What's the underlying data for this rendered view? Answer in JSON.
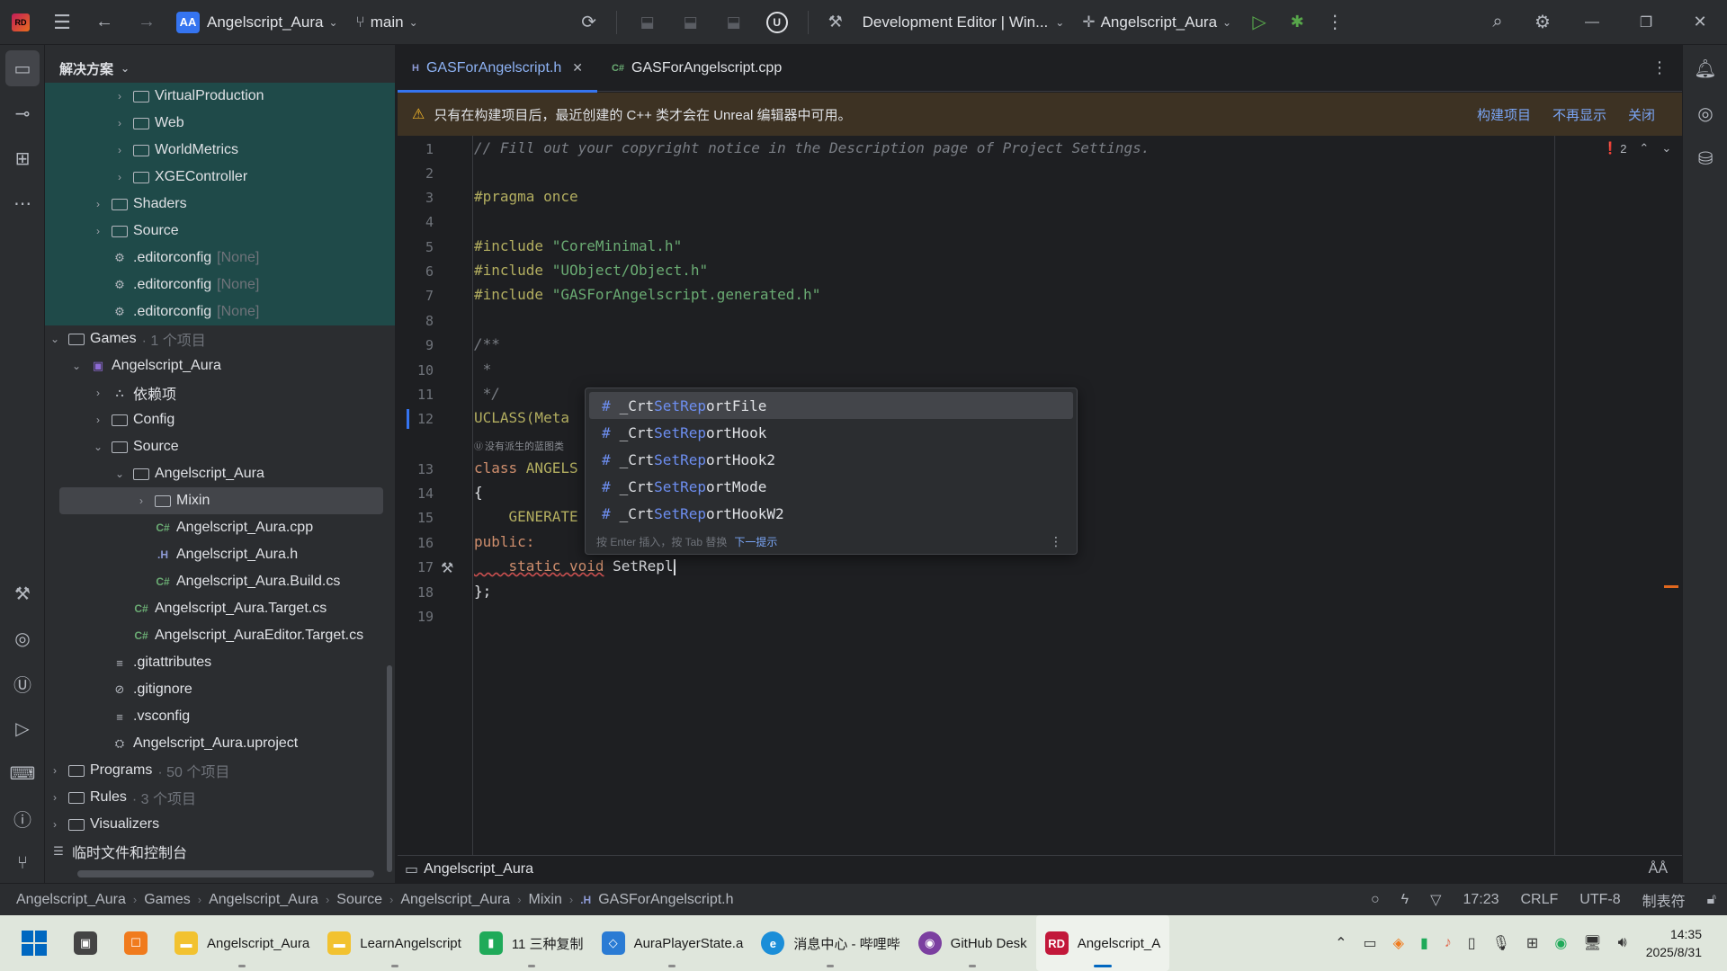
{
  "titlebar": {
    "project_badge": "AA",
    "project_name": "Angelscript_Aura",
    "branch": "main",
    "config": "Development Editor | Win...",
    "run_target": "Angelscript_Aura"
  },
  "explorer": {
    "title": "解决方案",
    "rows": [
      {
        "label": "VirtualProduction",
        "extra": ""
      },
      {
        "label": "Web",
        "extra": ""
      },
      {
        "label": "WorldMetrics",
        "extra": ""
      },
      {
        "label": "XGEController",
        "extra": ""
      },
      {
        "label": "Shaders",
        "extra": ""
      },
      {
        "label": "Source",
        "extra": ""
      },
      {
        "label": ".editorconfig",
        "extra": "[None]"
      },
      {
        "label": ".editorconfig",
        "extra": "[None]"
      },
      {
        "label": ".editorconfig",
        "extra": "[None]"
      },
      {
        "label": "Games",
        "extra": "· 1 个项目"
      },
      {
        "label": "Angelscript_Aura",
        "extra": ""
      },
      {
        "label": "依赖项",
        "extra": ""
      },
      {
        "label": "Config",
        "extra": ""
      },
      {
        "label": "Source",
        "extra": ""
      },
      {
        "label": "Angelscript_Aura",
        "extra": ""
      },
      {
        "label": "Mixin",
        "extra": ""
      },
      {
        "label": "Angelscript_Aura.cpp",
        "extra": ""
      },
      {
        "label": "Angelscript_Aura.h",
        "extra": ""
      },
      {
        "label": "Angelscript_Aura.Build.cs",
        "extra": ""
      },
      {
        "label": "Angelscript_Aura.Target.cs",
        "extra": ""
      },
      {
        "label": "Angelscript_AuraEditor.Target.cs",
        "extra": ""
      },
      {
        "label": ".gitattributes",
        "extra": ""
      },
      {
        "label": ".gitignore",
        "extra": ""
      },
      {
        "label": ".vsconfig",
        "extra": ""
      },
      {
        "label": "Angelscript_Aura.uproject",
        "extra": ""
      },
      {
        "label": "Programs",
        "extra": "· 50 个项目"
      },
      {
        "label": "Rules",
        "extra": "· 3 个项目"
      },
      {
        "label": "Visualizers",
        "extra": ""
      },
      {
        "label": "临时文件和控制台",
        "extra": ""
      }
    ]
  },
  "tabs": [
    {
      "ext": "H",
      "label": "GASForAngelscript.h"
    },
    {
      "ext": "C#",
      "label": "GASForAngelscript.cpp"
    }
  ],
  "banner": {
    "message": "只有在构建项目后，最近创建的 C++ 类才会在 Unreal 编辑器中可用。",
    "build": "构建项目",
    "dont_show": "不再显示",
    "close": "关闭"
  },
  "editor": {
    "error_count": "2",
    "line_numbers": [
      "1",
      "2",
      "3",
      "4",
      "5",
      "6",
      "7",
      "8",
      "9",
      "10",
      "11",
      "12",
      "13",
      "14",
      "15",
      "16",
      "17",
      "18",
      "19"
    ],
    "lines": {
      "l1": "// Fill out your copyright notice in the Description page of Project Settings.",
      "l3": "#pragma once",
      "l5a": "#include ",
      "l5b": "\"CoreMinimal.h\"",
      "l6a": "#include ",
      "l6b": "\"UObject/Object.h\"",
      "l7a": "#include ",
      "l7b": "\"GASForAngelscript.generated.h\"",
      "l9": "/**",
      "l10": " *",
      "l11": " */",
      "l12": "UCLASS(Meta",
      "hint12": "没有派生的蓝图类",
      "l13a": "class ",
      "l13b": "ANGELS",
      "l14": "{",
      "l15": "    GENERATE",
      "l16": "public:",
      "l17a": "    static",
      "l17b": " void",
      "l17c": " SetRepl",
      "l18": "};"
    }
  },
  "completion": {
    "items": [
      {
        "pre": "_Crt",
        "match": "SetRep",
        "post": "ortFile"
      },
      {
        "pre": "_Crt",
        "match": "SetRep",
        "post": "ortHook"
      },
      {
        "pre": "_Crt",
        "match": "SetRep",
        "post": "ortHook2"
      },
      {
        "pre": "_Crt",
        "match": "SetRep",
        "post": "ortMode"
      },
      {
        "pre": "_Crt",
        "match": "SetRep",
        "post": "ortHookW2"
      }
    ],
    "footer": "按 Enter 插入，按 Tab 替换",
    "next_tip": "下一提示"
  },
  "editor_footer": {
    "label": "Angelscript_Aura"
  },
  "statusbar": {
    "crumbs": [
      "Angelscript_Aura",
      "Games",
      "Angelscript_Aura",
      "Source",
      "Angelscript_Aura",
      "Mixin",
      "GASForAngelscript.h"
    ],
    "position": "17:23",
    "line_ending": "CRLF",
    "encoding": "UTF-8",
    "indent": "制表符"
  },
  "taskbar": {
    "apps": [
      {
        "label": "Angelscript_Aura",
        "color": "#f2c230"
      },
      {
        "label": "LearnAngelscript",
        "color": "#f2c230"
      },
      {
        "label": "11 三种复制",
        "color": "#1faa59"
      },
      {
        "label": "AuraPlayerState.a",
        "color": "#2a7bd4"
      },
      {
        "label": "消息中心 - 哔哩哔",
        "color": "#1b8ed8"
      },
      {
        "label": "GitHub Desk",
        "color": "#7b3fa0"
      },
      {
        "label": "Angelscript_A",
        "color": "#c2183a"
      }
    ],
    "time": "14:35",
    "date": "2025/8/31"
  }
}
